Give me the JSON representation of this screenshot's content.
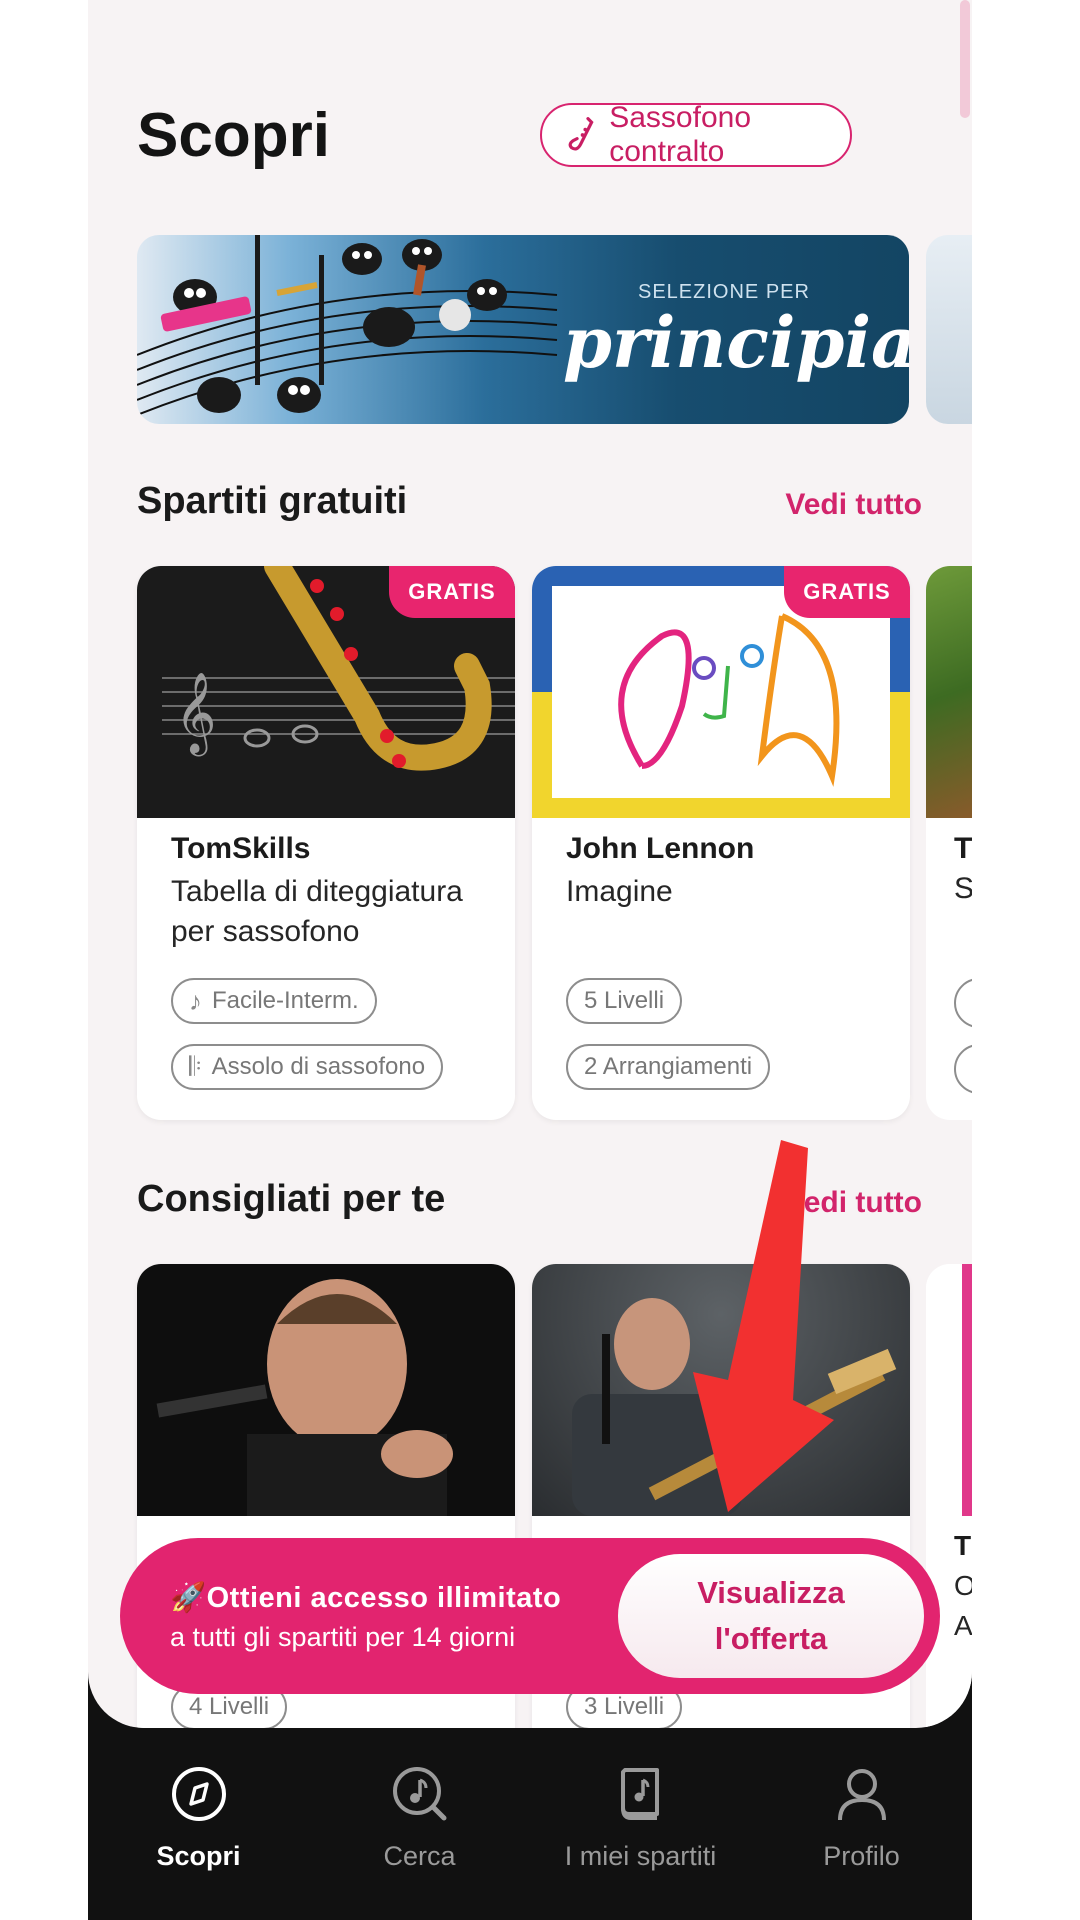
{
  "header": {
    "title": "Scopri",
    "instrument_chip": "Sassofono contralto"
  },
  "banner": {
    "subtitle": "SELEZIONE PER",
    "title": "principianti"
  },
  "free_section": {
    "title": "Spartiti gratuiti",
    "see_all": "Vedi tutto",
    "cards": [
      {
        "badge": "GRATIS",
        "artist": "TomSkills",
        "song": "Tabella di diteggiatura per sassofono",
        "tags": [
          "Facile-Interm.",
          "Assolo di sassofono"
        ]
      },
      {
        "badge": "GRATIS",
        "artist": "John Lennon",
        "song": "Imagine",
        "tags": [
          "5 Livelli",
          "2 Arrangiamenti"
        ]
      }
    ],
    "partial_card": {
      "artist": "T",
      "song": "S"
    }
  },
  "recommended_section": {
    "title": "Consigliati per te",
    "see_all": "Vedi tutto",
    "cards": [
      {
        "tag": "4 Livelli"
      },
      {
        "tag": "3 Livelli"
      }
    ],
    "partial_card": {
      "line1": "T",
      "line2": "O",
      "line3": "A"
    }
  },
  "promo": {
    "line1": "Ottieni accesso illimitato",
    "line2": "a tutti gli spartiti per 14 giorni",
    "button": "Visualizza\nl'offerta"
  },
  "nav": [
    {
      "label": "Scopri",
      "icon": "compass-icon",
      "active": true
    },
    {
      "label": "Cerca",
      "icon": "search-music-icon",
      "active": false
    },
    {
      "label": "I miei spartiti",
      "icon": "sheet-book-icon",
      "active": false
    },
    {
      "label": "Profilo",
      "icon": "user-icon",
      "active": false
    }
  ],
  "colors": {
    "accent": "#e2246f",
    "nav_bg": "#111111",
    "annotation_arrow": "#f23030"
  }
}
